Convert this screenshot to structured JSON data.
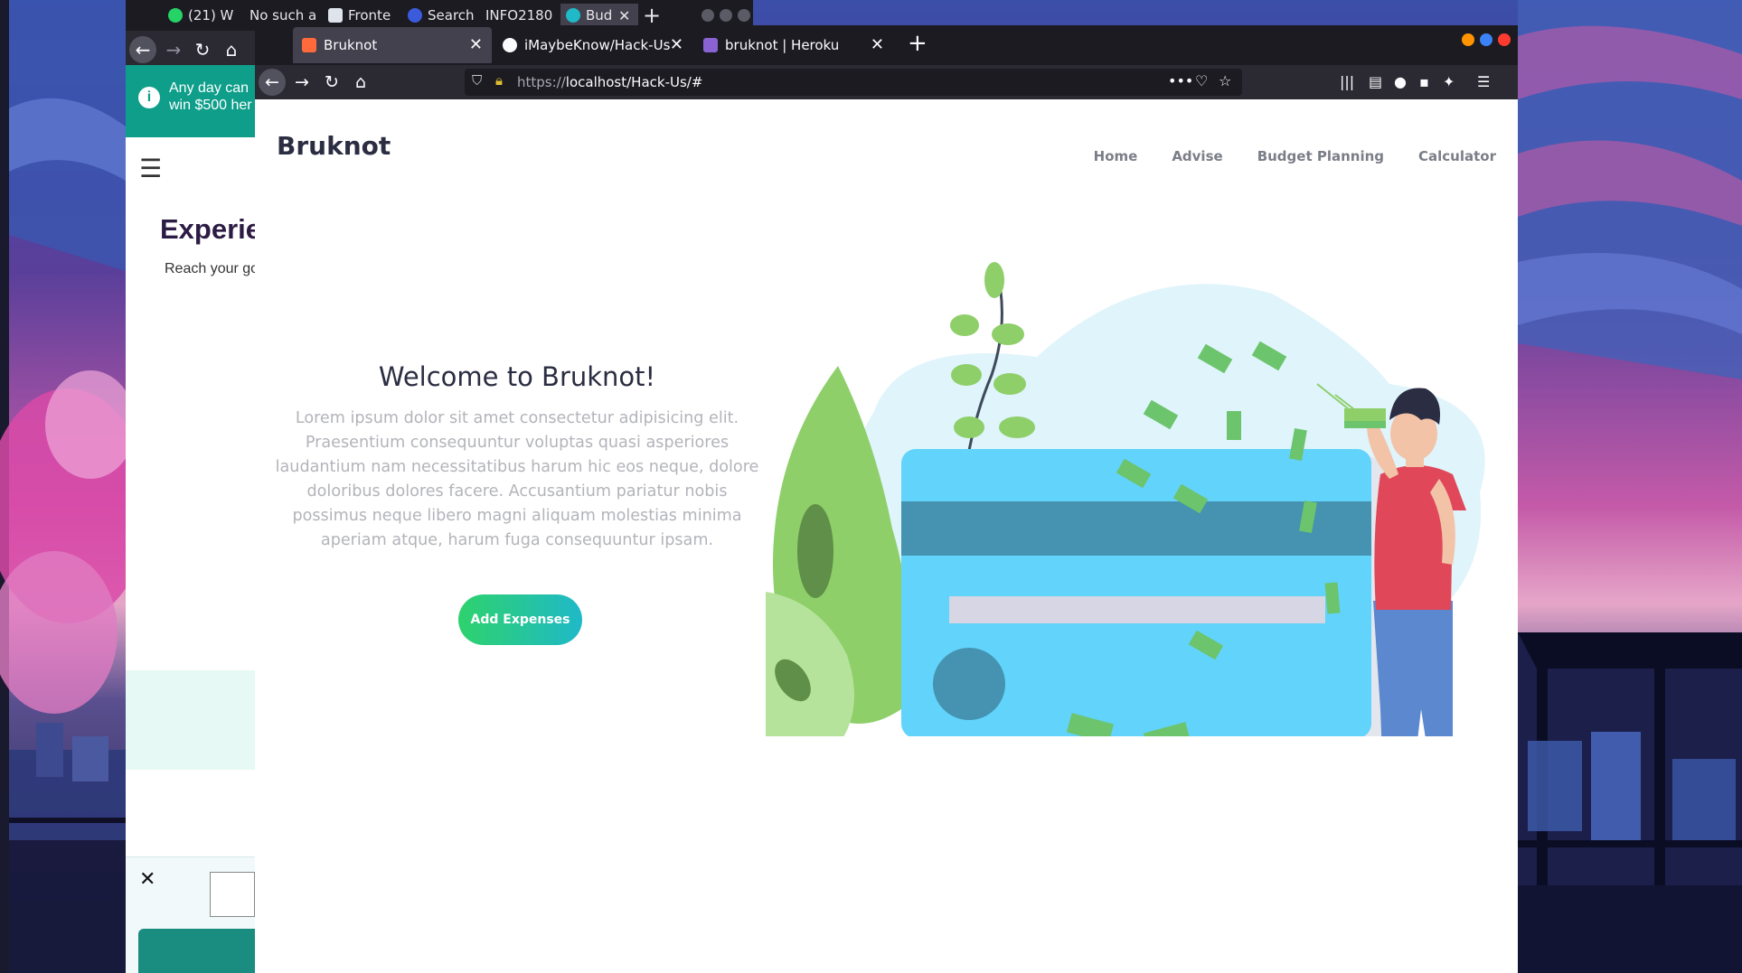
{
  "background_browser": {
    "tabs": [
      {
        "label": "(21) W",
        "icon": "whatsapp-icon"
      },
      {
        "label": "No such a",
        "icon": ""
      },
      {
        "label": "Fronte",
        "icon": "document-icon"
      },
      {
        "label": "Search",
        "icon": "search-engine-icon"
      },
      {
        "label": "INFO2180",
        "icon": ""
      },
      {
        "label": "Bud",
        "icon": "droplet-icon"
      }
    ],
    "banner_text": "Any day can\nwin $500 her",
    "heading": "Experie",
    "subtext": "Reach your go"
  },
  "browser": {
    "tabs": [
      {
        "label": "Bruknot",
        "icon": "localhost-favicon-icon",
        "active": true
      },
      {
        "label": "iMaybeKnow/Hack-Us",
        "icon": "github-icon",
        "active": false
      },
      {
        "label": "bruknot | Heroku",
        "icon": "heroku-icon",
        "active": false
      }
    ],
    "url": {
      "scheme": "https://",
      "host_path": "localhost/Hack-Us/#"
    }
  },
  "site": {
    "brand": "Bruknot",
    "nav": [
      "Home",
      "Advise",
      "Budget Planning",
      "Calculator"
    ],
    "hero_title": "Welcome to Bruknot!",
    "hero_text": "Lorem ipsum dolor sit amet consectetur adipisicing elit. Praesentium consequuntur voluptas quasi asperiores laudantium nam necessitatibus harum hic eos neque, dolore doloribus dolores facere. Accusantium pariatur nobis possimus neque libero magni aliquam molestias minima aperiam atque, harum fuga consequuntur ipsam.",
    "cta_label": "Add Expenses"
  },
  "colors": {
    "brand_text": "#2b2d42",
    "nav_text": "#7b7e88",
    "cta_gradient_start": "#2ed26c",
    "cta_gradient_end": "#1fb9c8",
    "card": "#62d3fb",
    "card_stripe": "#4593b0"
  }
}
